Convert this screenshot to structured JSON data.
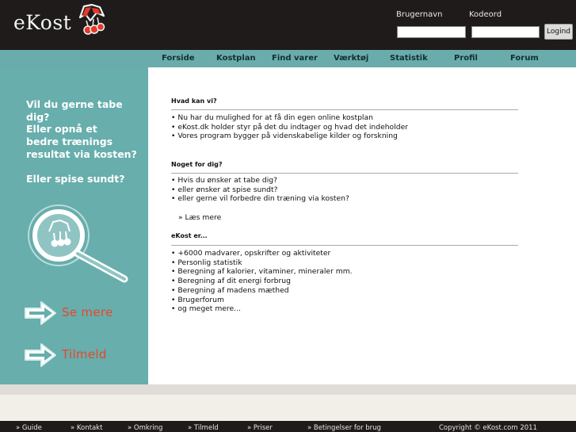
{
  "header": {
    "logo_text": "eKost",
    "username_label": "Brugernavn",
    "password_label": "Kodeord",
    "login_button": "Logind",
    "username_value": "",
    "password_value": ""
  },
  "nav": {
    "items": [
      "Forside",
      "Kostplan",
      "Find varer",
      "Værktøj",
      "Statistik",
      "Profil",
      "Forum"
    ]
  },
  "sidebar": {
    "question1": "Vil du gerne tabe dig?",
    "question2_lines": [
      "Eller opnå et",
      "bedre trænings",
      "resultat via  kosten?"
    ],
    "question3": "Eller spise sundt?",
    "see_more": "Se mere",
    "signup": "Tilmeld"
  },
  "main": {
    "sections": [
      {
        "title": "Hvad kan vi?",
        "items": [
          "Nu har du mulighed for at få din egen online kostplan",
          "eKost.dk holder styr på det du indtager og hvad det indeholder",
          "Vores program bygger på videnskabelige kilder og forskning"
        ]
      },
      {
        "title": "Noget for dig?",
        "items": [
          "Hvis du ønsker at tabe dig?",
          "eller ønsker at spise sundt?",
          "eller gerne vil forbedre din træning via kosten?"
        ]
      },
      {
        "title": "eKost er...",
        "items": [
          "+6000 madvarer, opskrifter og aktiviteter",
          "Personlig statistik",
          "Beregning af kalorier, vitaminer, mineraler mm.",
          "Beregning af dit energi forbrug",
          "Beregning af madens mæthed",
          "Brugerforum",
          "og meget mere..."
        ]
      }
    ],
    "read_more": "» Læs mere"
  },
  "footer": {
    "links": [
      "» Guide",
      "» Kontakt",
      "» Omkring",
      "» Tilmeld",
      "» Priser",
      "» Betingelser for brug"
    ],
    "copyright": "Copyright © eKost.com 2011"
  },
  "colors": {
    "header_bg": "#1e1b1a",
    "nav_bg": "#6aacab",
    "sidebar_bg": "#67aeac",
    "accent": "#e8472b"
  },
  "icons": [
    "cherry-logo-icon",
    "magnifier-icon",
    "arrow-right-icon"
  ]
}
